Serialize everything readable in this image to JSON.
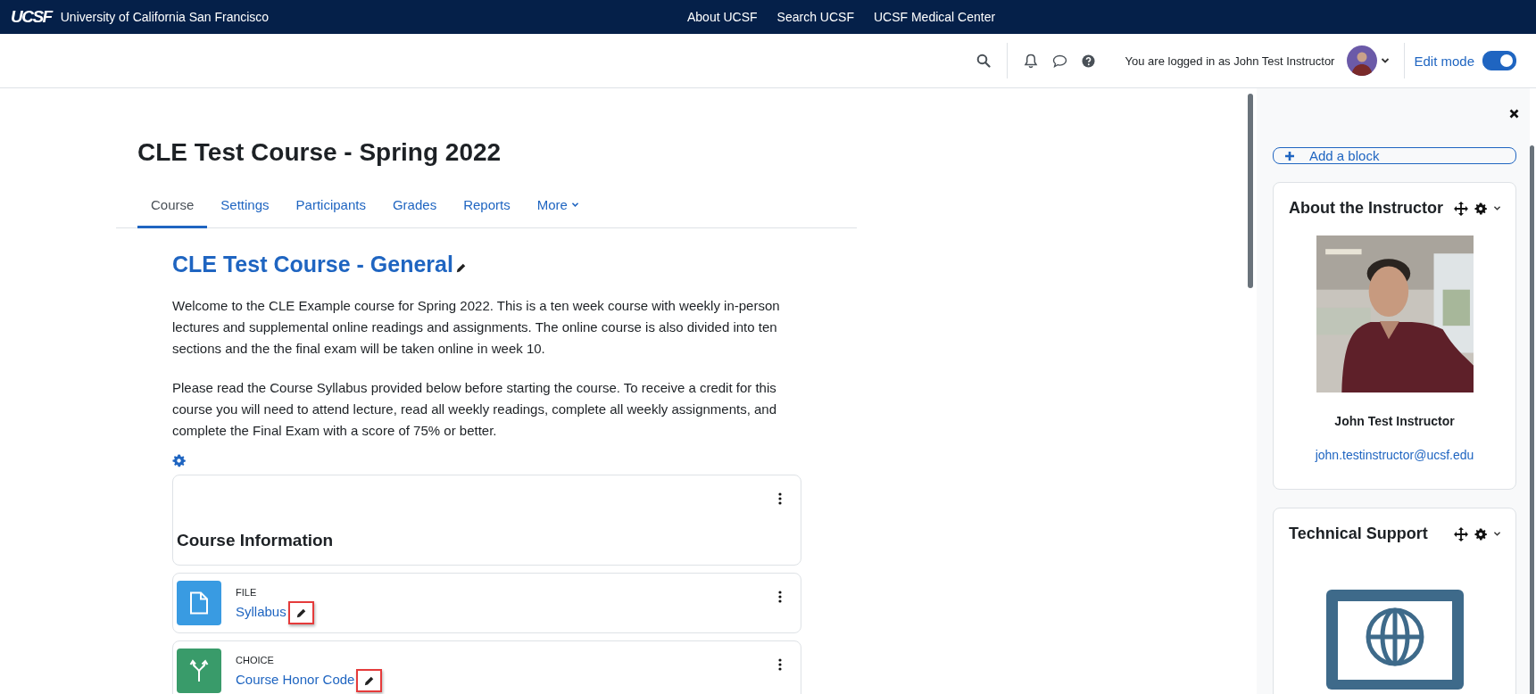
{
  "topbar": {
    "brand": "University of California San Francisco",
    "logo": "UCSF",
    "links": [
      "About UCSF",
      "Search UCSF",
      "UCSF Medical Center"
    ]
  },
  "navbar": {
    "logged_in": "You are logged in as John Test Instructor",
    "edit_mode": {
      "label": "Edit mode",
      "on": true
    }
  },
  "course": {
    "title": "CLE Test Course - Spring 2022",
    "tabs": [
      {
        "label": "Course",
        "selected": true
      },
      {
        "label": "Settings",
        "selected": false
      },
      {
        "label": "Participants",
        "selected": false
      },
      {
        "label": "Grades",
        "selected": false
      },
      {
        "label": "Reports",
        "selected": false
      },
      {
        "label": "More",
        "selected": false
      }
    ]
  },
  "section": {
    "title": "CLE Test Course - General",
    "paragraphs": [
      "Welcome to the CLE Example course for Spring 2022. This is a ten week course with weekly in-person lectures and supplemental online readings and assignments. The online course is also divided into ten sections and the the final exam will be taken online in week 10.",
      "Please read the Course Syllabus provided below before starting the course. To receive a credit for this course you will need to attend lecture, read all weekly readings, complete all weekly assignments, and complete the Final Exam with a score of 75% or better."
    ],
    "label_title": "Course Information",
    "activities": [
      {
        "kind": "file",
        "type": "FILE",
        "name": "Syllabus",
        "highlighted": true
      },
      {
        "kind": "choice",
        "type": "CHOICE",
        "name": "Course Honor Code",
        "highlighted": true
      }
    ]
  },
  "drawer": {
    "add_block": "Add a block",
    "blocks": [
      {
        "kind": "instructor",
        "title": "About the Instructor",
        "name": "John Test Instructor",
        "email": "john.testinstructor@ucsf.edu"
      },
      {
        "kind": "support",
        "title": "Technical Support"
      }
    ]
  }
}
